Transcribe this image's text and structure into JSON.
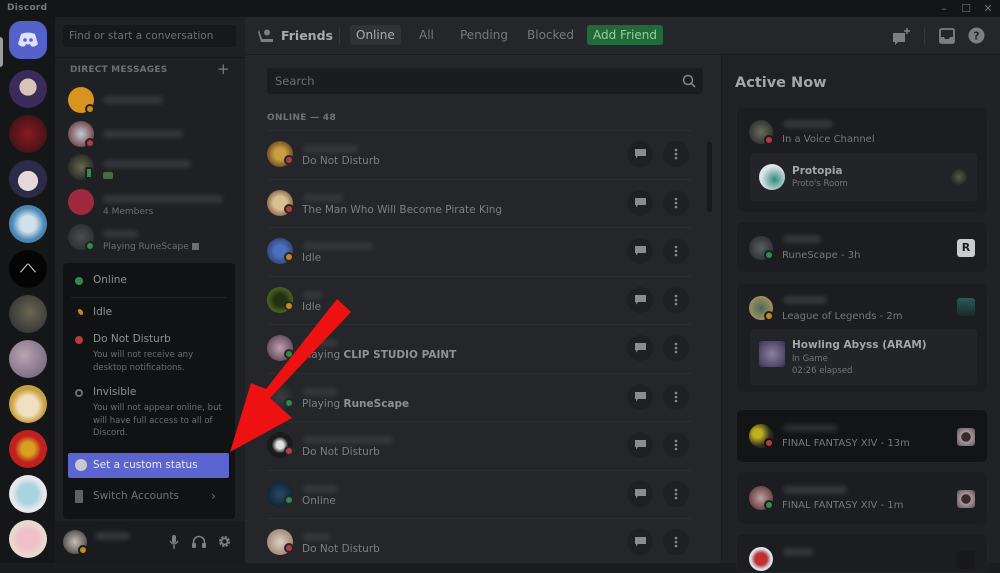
{
  "app": {
    "title": "Discord"
  },
  "window_controls": {
    "minimize": "–",
    "maximize": "☐",
    "close": "✕"
  },
  "dm_sidebar": {
    "search_placeholder": "Find or start a conversation",
    "section_title": "DIRECT MESSAGES",
    "add_icon": "+",
    "items": [
      {
        "subtitle": "",
        "status": "idle"
      },
      {
        "subtitle": "",
        "status": "dnd"
      },
      {
        "subtitle": "",
        "status": "mobile"
      },
      {
        "subtitle": "4 Members",
        "status": "group"
      },
      {
        "subtitle": "Playing RuneScape",
        "status": "online"
      }
    ]
  },
  "status_menu": {
    "items": [
      {
        "label": "Online",
        "desc": "",
        "status": "online",
        "color": "#2e8b4a"
      },
      {
        "label": "Idle",
        "desc": "",
        "status": "idle",
        "color": "#c6891d"
      },
      {
        "label": "Do Not Disturb",
        "desc": "You will not receive any desktop notifications.",
        "status": "dnd",
        "color": "#b93a3e"
      },
      {
        "label": "Invisible",
        "desc": "You will not appear online, but will have full access to all of Discord.",
        "status": "invisible",
        "color": "#6d6f74"
      }
    ],
    "custom_status": "Set a custom status",
    "switch_accounts": "Switch Accounts"
  },
  "header": {
    "title": "Friends",
    "tabs": [
      "Online",
      "All",
      "Pending",
      "Blocked"
    ],
    "active_tab": "Online",
    "add_friend": "Add Friend"
  },
  "friends": {
    "search_placeholder": "Search",
    "online_label": "ONLINE — 48",
    "rows": [
      {
        "status_text": "Do Not Disturb",
        "status": "dnd",
        "game": ""
      },
      {
        "status_text": "The Man Who Will Become Pirate King",
        "status": "dnd",
        "game": ""
      },
      {
        "status_text": "Idle",
        "status": "idle",
        "game": ""
      },
      {
        "status_text": "Idle",
        "status": "idle",
        "game": ""
      },
      {
        "status_text": "Playing ",
        "status": "online",
        "game": "CLIP STUDIO PAINT"
      },
      {
        "status_text": "Playing ",
        "status": "online",
        "game": "RuneScape"
      },
      {
        "status_text": "Do Not Disturb",
        "status": "dnd",
        "game": ""
      },
      {
        "status_text": "Online",
        "status": "online",
        "game": ""
      },
      {
        "status_text": "Do Not Disturb",
        "status": "dnd",
        "game": ""
      }
    ]
  },
  "active_now": {
    "title": "Active Now",
    "cards": [
      {
        "activity": "In a Voice Channel",
        "status": "dnd",
        "inner": {
          "title": "Protopia",
          "lines": [
            "Proto's Room"
          ]
        }
      },
      {
        "activity": "RuneScape - 3h",
        "status": "online"
      },
      {
        "activity": "League of Legends - 2m",
        "status": "idle",
        "inner": {
          "title": "Howling Abyss (ARAM)",
          "lines": [
            "In Game",
            "02:26 elapsed"
          ]
        }
      },
      {
        "activity": "FINAL FANTASY XIV - 13m",
        "status": "dnd"
      },
      {
        "activity": "FINAL FANTASY XIV - 1m",
        "status": "online"
      },
      {
        "activity": "",
        "status": "online"
      }
    ]
  },
  "colors": {
    "blurple": "#5461c9",
    "online": "#2e8b4a",
    "idle": "#c6891d",
    "dnd": "#b93a3e",
    "add_friend": "#236a3a",
    "annotation_arrow": "#ee1111"
  }
}
